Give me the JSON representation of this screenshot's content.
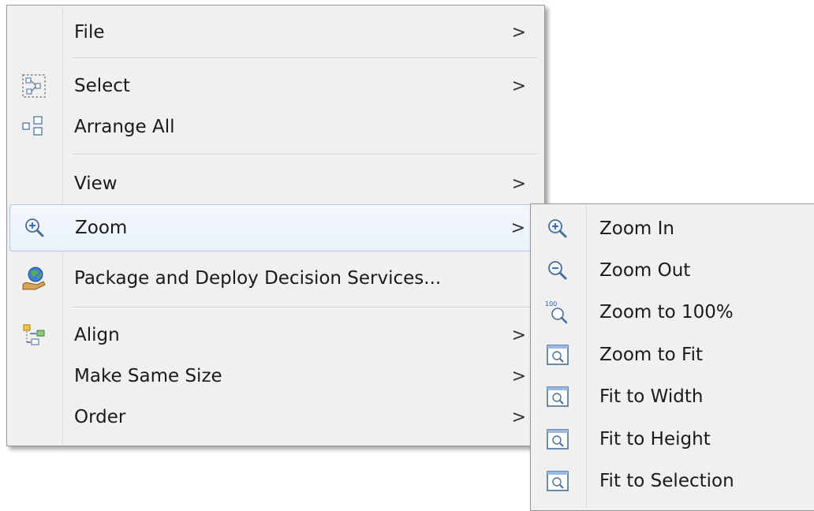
{
  "main_menu": {
    "items": [
      {
        "label": "File",
        "arrow": ">"
      },
      {
        "label": "Select",
        "arrow": ">",
        "icon": "select-all-icon"
      },
      {
        "label": "Arrange All",
        "icon": "arrange-all-icon"
      },
      {
        "label": "View",
        "arrow": ">"
      },
      {
        "label": "Zoom",
        "arrow": ">",
        "icon": "zoom-icon"
      },
      {
        "label": "Package and Deploy Decision Services...",
        "icon": "package-deploy-icon"
      },
      {
        "label": "Align",
        "arrow": ">",
        "icon": "align-icon"
      },
      {
        "label": "Make Same Size",
        "arrow": ">"
      },
      {
        "label": "Order",
        "arrow": ">"
      }
    ]
  },
  "zoom_submenu": {
    "items": [
      {
        "label": "Zoom In",
        "icon": "zoom-in-icon"
      },
      {
        "label": "Zoom Out",
        "icon": "zoom-out-icon"
      },
      {
        "label": "Zoom to 100%",
        "icon": "zoom-100-icon",
        "icon_text": "100"
      },
      {
        "label": "Zoom to Fit",
        "icon": "zoom-to-fit-icon"
      },
      {
        "label": "Fit to Width",
        "icon": "fit-to-width-icon"
      },
      {
        "label": "Fit to Height",
        "icon": "fit-to-height-icon"
      },
      {
        "label": "Fit to Selection",
        "icon": "fit-to-selection-icon"
      }
    ]
  },
  "colors": {
    "menu_bg": "#f0f0f0",
    "hover_border": "#aecbeb",
    "icon_blue": "#3a6fb5"
  }
}
